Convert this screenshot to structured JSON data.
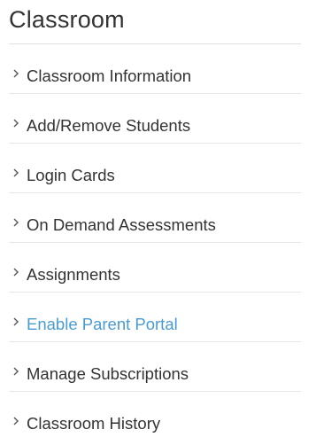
{
  "sidebar": {
    "title": "Classroom",
    "active_color": "#4a9bd1",
    "text_color": "#333333",
    "items": [
      {
        "label": "Classroom Information",
        "icon": "chevron-right-icon",
        "active": false
      },
      {
        "label": "Add/Remove Students",
        "icon": "chevron-right-icon",
        "active": false
      },
      {
        "label": "Login Cards",
        "icon": "chevron-right-icon",
        "active": false
      },
      {
        "label": "On Demand Assessments",
        "icon": "chevron-right-icon",
        "active": false
      },
      {
        "label": "Assignments",
        "icon": "chevron-right-icon",
        "active": false
      },
      {
        "label": "Enable Parent Portal",
        "icon": "chevron-right-icon",
        "active": true
      },
      {
        "label": "Manage Subscriptions",
        "icon": "chevron-right-icon",
        "active": false
      },
      {
        "label": "Classroom History",
        "icon": "chevron-right-icon",
        "active": false
      }
    ]
  }
}
